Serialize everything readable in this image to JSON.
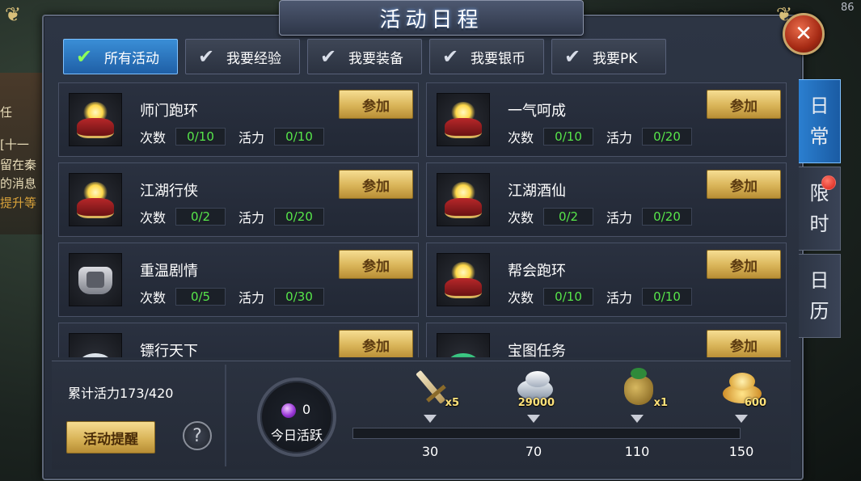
{
  "background": {
    "side_text": [
      "任",
      "[十一",
      "留在秦",
      "的消息",
      "提升等"
    ],
    "corner_number": "86"
  },
  "window": {
    "title": "活动日程",
    "close_icon": "close-icon"
  },
  "filters": [
    {
      "label": "所有活动",
      "active": true
    },
    {
      "label": "我要经验",
      "active": false
    },
    {
      "label": "我要装备",
      "active": false
    },
    {
      "label": "我要银币",
      "active": false
    },
    {
      "label": "我要PK",
      "active": false
    }
  ],
  "activity_labels": {
    "count": "次数",
    "vitality": "活力",
    "join": "参加"
  },
  "activities": [
    {
      "name": "师门跑环",
      "icon": "hat-icon",
      "count": "0/10",
      "vitality": "0/10"
    },
    {
      "name": "一气呵成",
      "icon": "hat-icon",
      "count": "0/10",
      "vitality": "0/20"
    },
    {
      "name": "江湖行侠",
      "icon": "hat-icon",
      "count": "0/2",
      "vitality": "0/20"
    },
    {
      "name": "江湖酒仙",
      "icon": "hat-icon",
      "count": "0/2",
      "vitality": "0/20"
    },
    {
      "name": "重温剧情",
      "icon": "armor-icon",
      "count": "0/5",
      "vitality": "0/30"
    },
    {
      "name": "帮会跑环",
      "icon": "hat-icon",
      "count": "0/10",
      "vitality": "0/10"
    },
    {
      "name": "镖行天下",
      "icon": "silver-icon",
      "count": "",
      "vitality": ""
    },
    {
      "name": "宝图任务",
      "icon": "jade-icon",
      "count": "",
      "vitality": ""
    }
  ],
  "side_tabs": [
    {
      "label": [
        "日",
        "常"
      ],
      "active": true,
      "badge": false
    },
    {
      "label": [
        "限",
        "时"
      ],
      "active": false,
      "badge": true
    },
    {
      "label": [
        "日",
        "历"
      ],
      "active": false,
      "badge": false
    }
  ],
  "summary": {
    "vitality_total": "累计活力173/420",
    "remind_label": "活动提醒",
    "help_label": "?",
    "daily_value": "0",
    "daily_label": "今日活跃",
    "progress": 0
  },
  "rewards": [
    {
      "icon": "sword-icon",
      "qty": "x5",
      "threshold": "30"
    },
    {
      "icon": "silver-ingot-icon",
      "qty": "29000",
      "threshold": "70"
    },
    {
      "icon": "treasure-bag-icon",
      "qty": "x1",
      "threshold": "110"
    },
    {
      "icon": "gold-coins-icon",
      "qty": "600",
      "threshold": "150"
    }
  ],
  "colors": {
    "accent": "#2b7fd0",
    "button_gold": "#d9b458",
    "value_green": "#57e64a"
  }
}
